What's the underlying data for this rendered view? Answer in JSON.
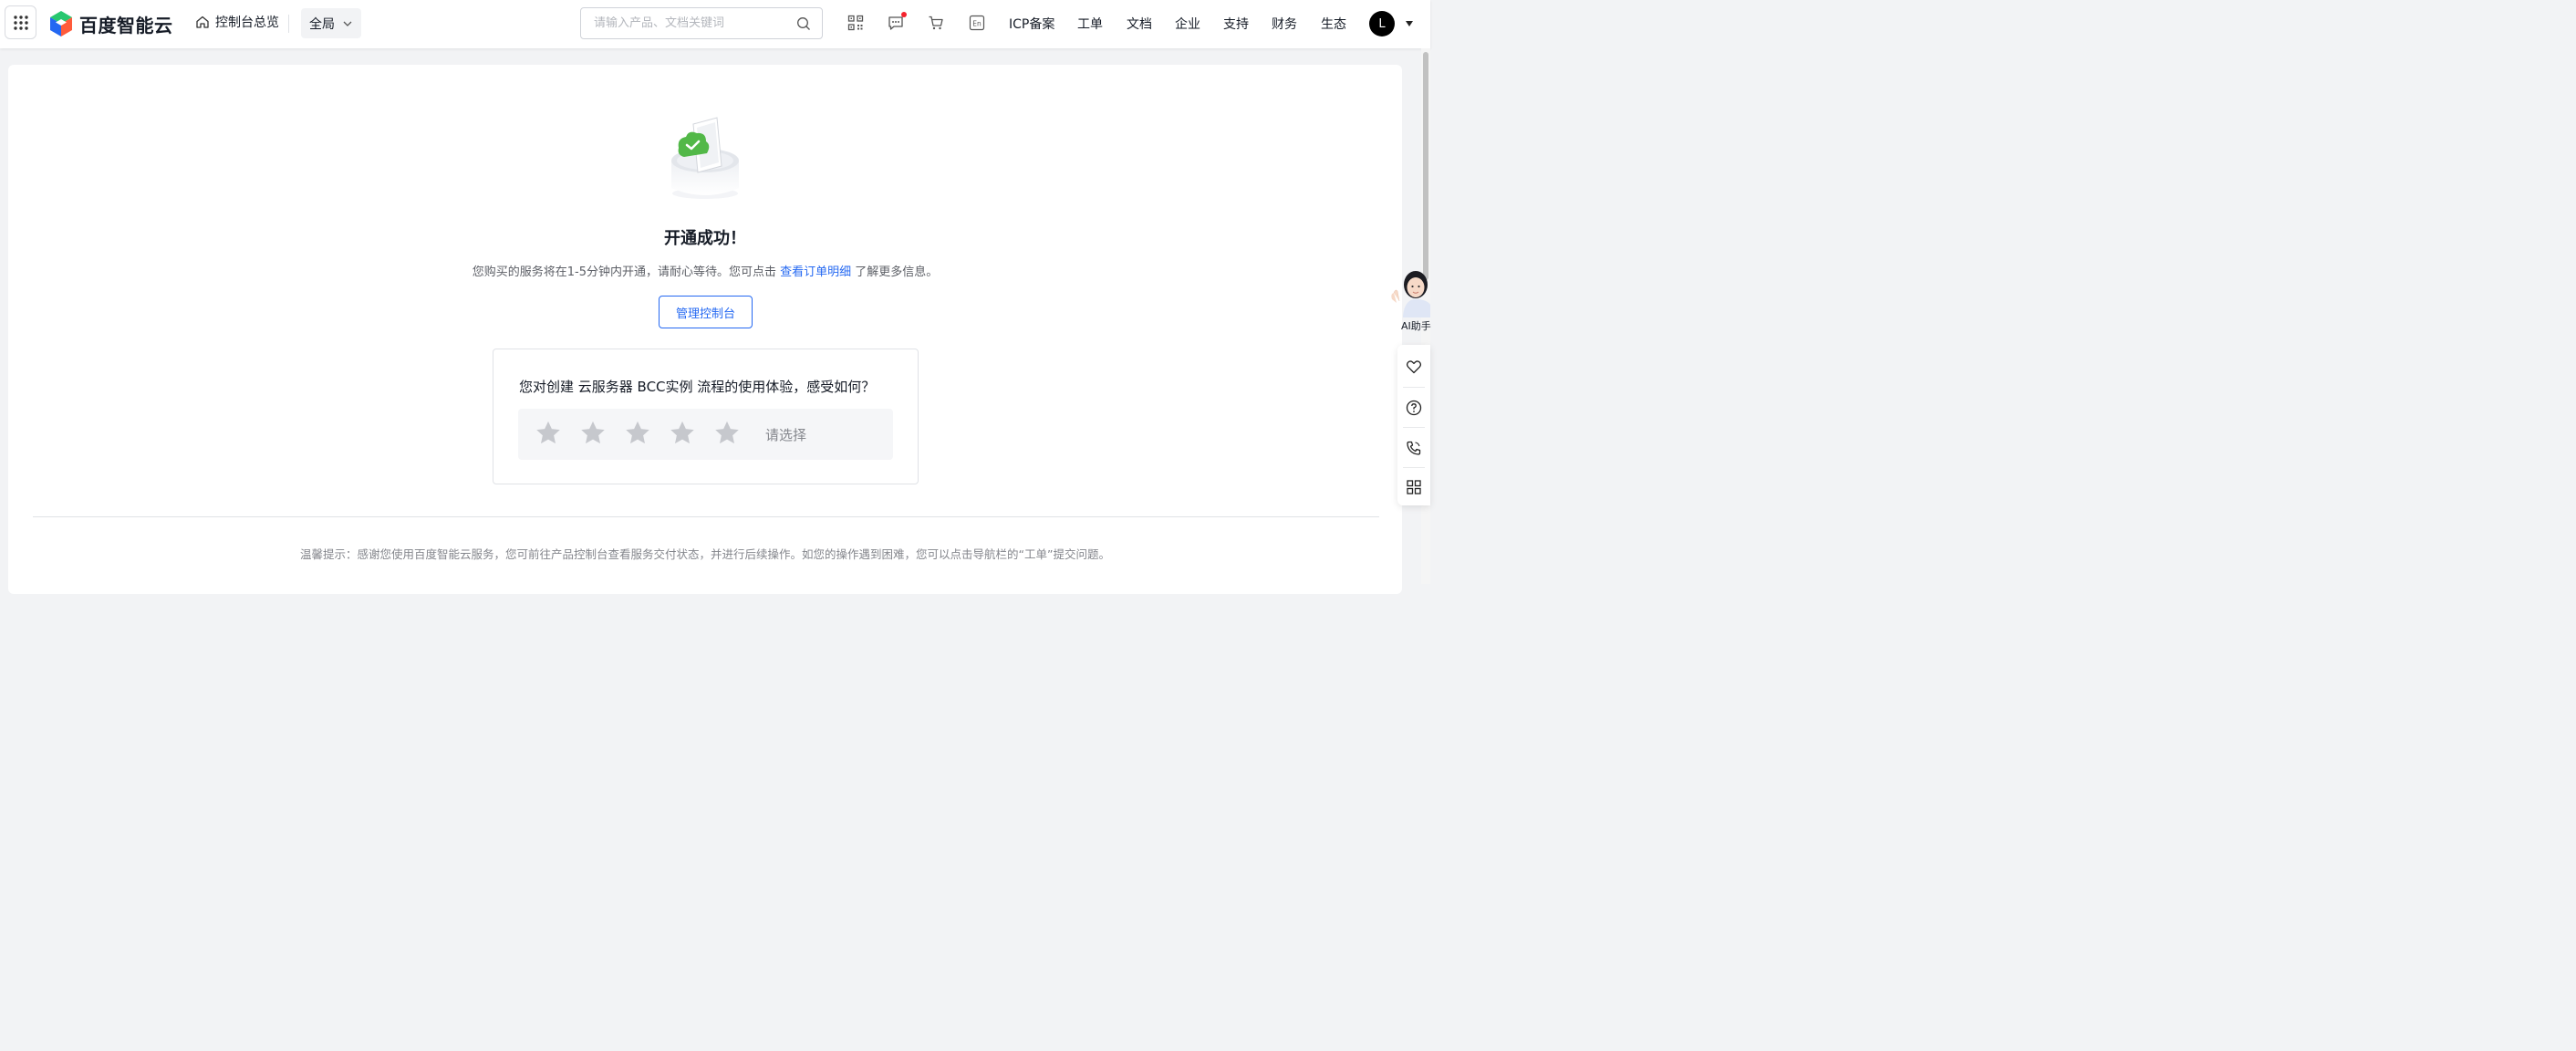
{
  "header": {
    "brand": "百度智能云",
    "overview_label": "控制台总览",
    "region_label": "全局",
    "search_placeholder": "请输入产品、文档关键词",
    "language_badge": "En",
    "nav": [
      "ICP备案",
      "工单",
      "文档",
      "企业",
      "支持",
      "财务",
      "生态"
    ],
    "avatar_initial": "L"
  },
  "icons": {
    "apps": "apps-grid-icon",
    "home": "home-icon",
    "chevron": "chevron-down-icon",
    "search": "search-icon",
    "qr": "qrcode-icon",
    "message": "message-icon",
    "cart": "cart-icon",
    "language": "language-en-icon"
  },
  "result": {
    "title": "开通成功！",
    "desc_before": "您购买的服务将在1-5分钟内开通，请耐心等待。您可点击 ",
    "desc_link": "查看订单明细",
    "desc_after": " 了解更多信息。",
    "manage_button": "管理控制台"
  },
  "survey": {
    "question": "您对创建 云服务器 BCC实例 流程的使用体验，感受如何？",
    "star_count": 5,
    "rating_value": 0,
    "placeholder": "请选择"
  },
  "footer": {
    "tip": "温馨提示：感谢您使用百度智能云服务，您可前往产品控制台查看服务交付状态，并进行后续操作。如您的操作遇到困难，您可以点击导航栏的“工单”提交问题。"
  },
  "float": {
    "ai_label": "AI助手",
    "tools": [
      "heart-icon",
      "help-icon",
      "phone-icon",
      "apps-icon"
    ]
  },
  "colors": {
    "primary": "#2468f2",
    "text": "#151b26",
    "secondary_text": "#5c5f66",
    "muted_text": "#84868c",
    "border": "#e0e2e6",
    "success_green": "#52c41a",
    "notification_red": "#f5222d"
  }
}
